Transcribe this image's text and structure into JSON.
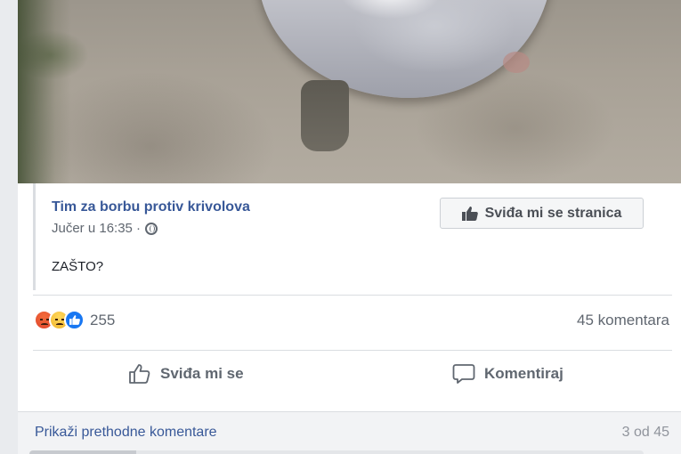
{
  "post": {
    "page_name": "Tim za borbu protiv krivolova",
    "timestamp": "Jučer u 16:35 ·",
    "privacy_icon": "globe-icon",
    "text": "ZAŠTO?",
    "like_page_label": "Sviđa mi se stranica"
  },
  "reactions": {
    "icons": [
      "angry-reaction-icon",
      "sad-reaction-icon",
      "like-reaction-icon"
    ],
    "count": "255",
    "comments": "45 komentara"
  },
  "actions": {
    "like_label": "Sviđa mi se",
    "comment_label": "Komentiraj"
  },
  "comments_bar": {
    "show_previous": "Prikaži prethodne komentare",
    "counter": "3 od 45"
  },
  "colors": {
    "link": "#385898",
    "secondary_text": "#606770",
    "like_blue": "#1877f2"
  }
}
